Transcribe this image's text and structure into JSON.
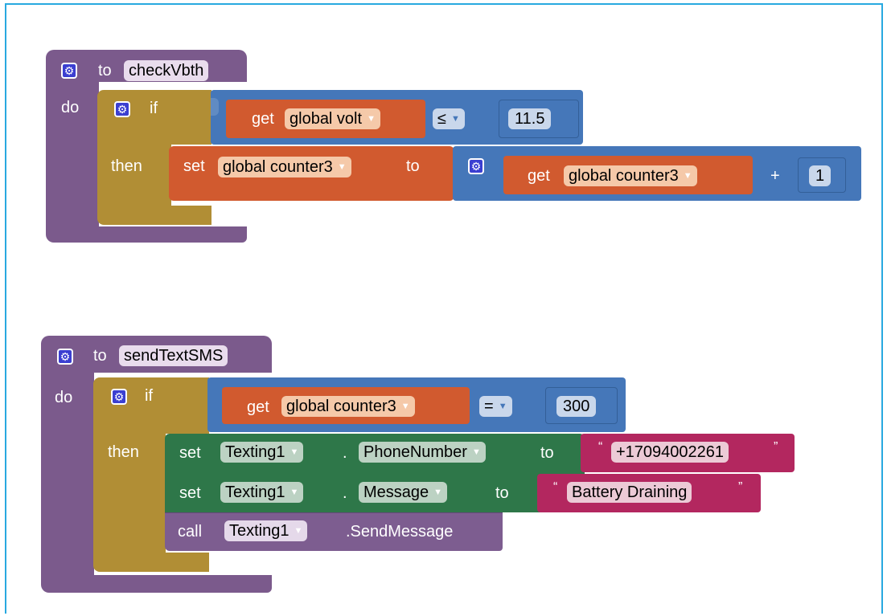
{
  "procedures": [
    {
      "to_label": "to",
      "name": "checkVbth",
      "do_label": "do",
      "if_label": "if",
      "then_label": "then",
      "condition": {
        "get_label": "get",
        "variable": "global volt",
        "operator": "≤",
        "value": "11.5"
      },
      "statement": {
        "set_label": "set",
        "variable": "global counter3",
        "to_label": "to",
        "get_label": "get",
        "get_variable": "global counter3",
        "plus": "+",
        "addend": "1"
      }
    },
    {
      "to_label": "to",
      "name": "sendTextSMS",
      "do_label": "do",
      "if_label": "if",
      "then_label": "then",
      "condition": {
        "get_label": "get",
        "variable": "global counter3",
        "operator": "=",
        "value": "300"
      },
      "statements": [
        {
          "set_label": "set",
          "component": "Texting1",
          "dot": ".",
          "property": "PhoneNumber",
          "to_label": "to",
          "text": "+17094002261"
        },
        {
          "set_label": "set",
          "component": "Texting1",
          "dot": ".",
          "property": "Message",
          "to_label": "to",
          "text": "Battery Draining"
        },
        {
          "call_label": "call",
          "component": "Texting1",
          "method": ".SendMessage"
        }
      ]
    }
  ],
  "colors": {
    "procedure": "#7b5a8c",
    "control": "#b18e35",
    "math": "#4577b9",
    "variable": "#d15a2f",
    "component_setter": "#2e7749",
    "text": "#b3275f",
    "frame_border": "#28a9e0"
  },
  "icons": {
    "mutator": "gear-icon",
    "dropdown": "dropdown-arrow-icon"
  }
}
